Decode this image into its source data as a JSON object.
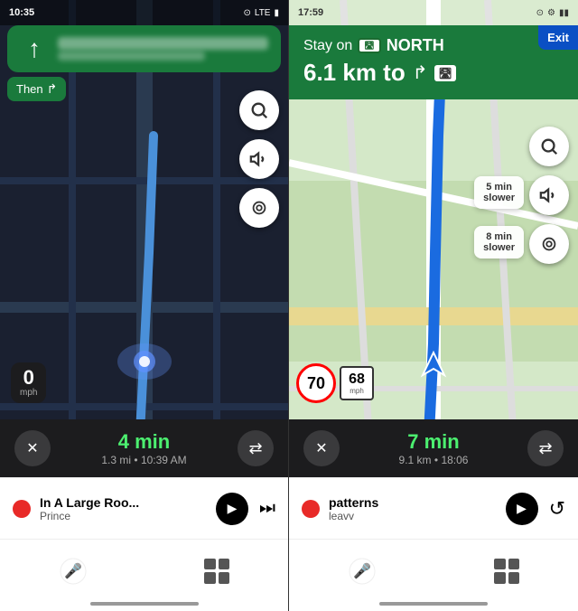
{
  "left": {
    "status": {
      "time": "10:35",
      "signal": "LTE",
      "battery": "▮"
    },
    "nav": {
      "direction": "↑",
      "then_label": "Then",
      "then_arrow": "↱"
    },
    "speed": {
      "value": "0",
      "unit": "mph"
    },
    "eta": {
      "time": "4 min",
      "distance": "1.3 mi",
      "arrival": "10:39 AM"
    },
    "media": {
      "title": "In A Large Roo...",
      "artist": "Prince"
    },
    "buttons": {
      "close": "✕",
      "routes": "⇄"
    }
  },
  "right": {
    "status": {
      "time": "17:59"
    },
    "nav": {
      "stay_on": "Stay on",
      "road_label": "NORTH",
      "distance": "6.1 km to",
      "exit_label": "Exit"
    },
    "traffic": {
      "warn1_line1": "5 min",
      "warn1_line2": "slower",
      "warn2_line1": "8 min",
      "warn2_line2": "slower"
    },
    "speed_limit": "70",
    "speed_current": "68",
    "speed_unit": "mph",
    "eta": {
      "time": "7 min",
      "distance": "9.1 km",
      "arrival": "18:06"
    },
    "media": {
      "title": "patterns",
      "artist": "leavv"
    },
    "buttons": {
      "close": "✕",
      "routes": "⇄",
      "replay": "↺"
    }
  }
}
